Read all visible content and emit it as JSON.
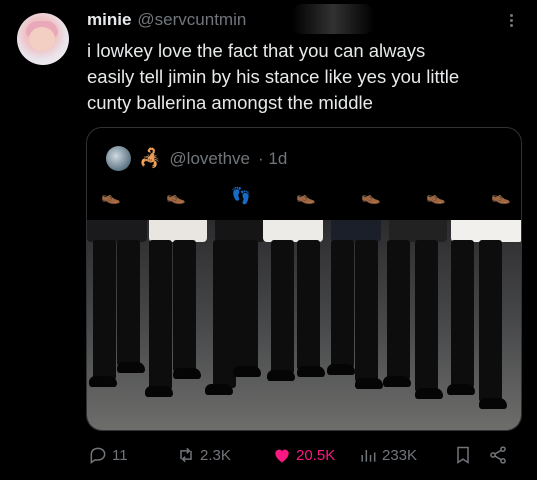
{
  "author": {
    "display_name": "minie",
    "handle": "@servcuntmin"
  },
  "tweet": {
    "lines": [
      "i lowkey love the fact that you can always",
      "easily tell jimin by his stance like yes you little",
      "cunty ballerina amongst the middle"
    ]
  },
  "quote": {
    "emoji": "🦂",
    "handle": "@lovethve",
    "time": "· 1d",
    "emoji_row": [
      "👞",
      "👞",
      "👣",
      "👞",
      "👞",
      "👞",
      "👞"
    ]
  },
  "actions": {
    "replies": "11",
    "reposts": "2.3K",
    "likes": "20.5K",
    "views": "233K"
  },
  "colors": {
    "like": "#f91880",
    "muted": "#71767b",
    "text": "#e7e9ea"
  }
}
